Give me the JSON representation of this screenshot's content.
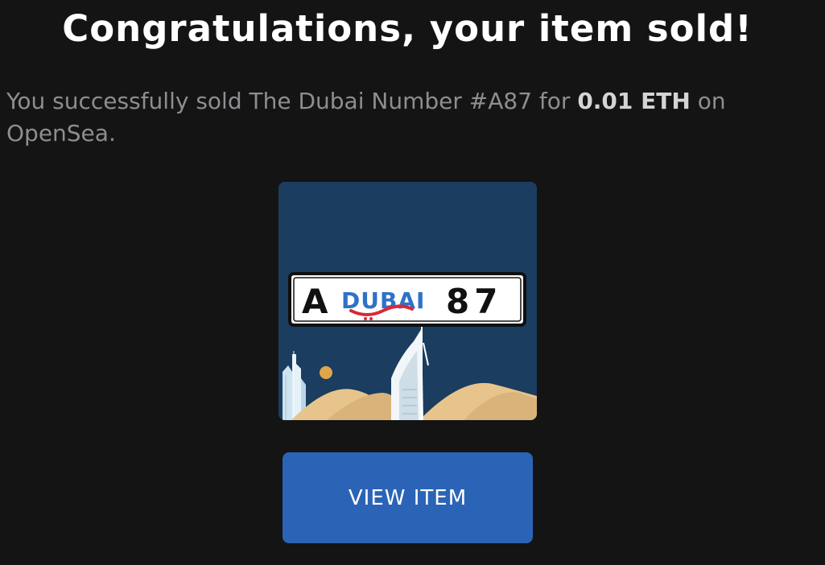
{
  "header": {
    "title": "Congratulations, your item sold!"
  },
  "message": {
    "prefix": "You successfully sold The Dubai Number #A87 for ",
    "price": "0.01 ETH",
    "suffix": " on OpenSea."
  },
  "nft": {
    "plate_letter": "A",
    "plate_brand": "DUBAI",
    "plate_number": "87",
    "colors": {
      "background": "#1b3d5f",
      "plate_blue": "#2f72c8",
      "plate_red": "#d8283a",
      "sand": "#e7c48c",
      "sun": "#e0a74a"
    }
  },
  "actions": {
    "view_item_label": "VIEW ITEM"
  }
}
